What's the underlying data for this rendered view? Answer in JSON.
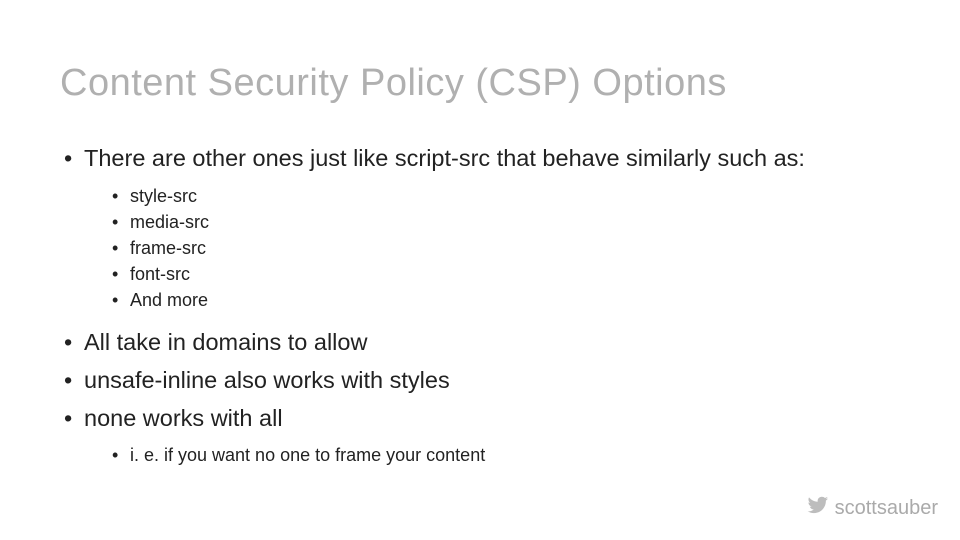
{
  "title": "Content Security Policy (CSP) Options",
  "bullets": {
    "b0": "There are other ones just like script-src that behave similarly such as:",
    "b0_sub": {
      "s0": "style-src",
      "s1": "media-src",
      "s2": "frame-src",
      "s3": "font-src",
      "s4": "And more"
    },
    "b1": "All take in domains to allow",
    "b2": "unsafe-inline also works with styles",
    "b3": "none works with all",
    "b3_sub": {
      "s0": "i. e. if you want no one to frame your content"
    }
  },
  "footer": {
    "handle": "scottsauber",
    "icon": "twitter-icon"
  }
}
